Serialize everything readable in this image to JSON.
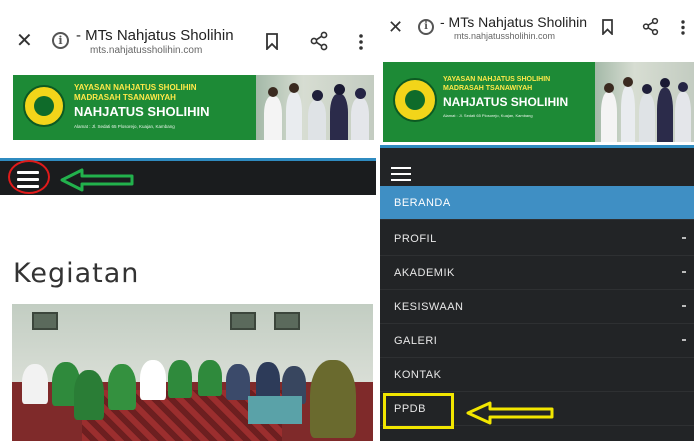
{
  "browser": {
    "close_icon": "close-icon",
    "info_icon": "info-icon",
    "info_glyph": "i",
    "bookmark_icon": "bookmark-icon",
    "share_icon": "share-icon",
    "menu_icon": "more-vertical-icon",
    "title": "- MTs Nahjatus Sholihin",
    "url": "mts.nahjatussholihin.com"
  },
  "banner": {
    "line1": "YAYASAN NAHJATUS SHOLIHIN",
    "line2": "MADRASAH TSANAWIYAH",
    "line3": "NAHJATUS SHOLIHIN",
    "line4": "Alamat : Jl. Sedati 65 Plosorejo, Kuajan, Kambang"
  },
  "page": {
    "heading": "Kegiatan"
  },
  "menu": {
    "items": [
      {
        "label": "BERANDA",
        "active": true,
        "has_submenu": false
      },
      {
        "label": "PROFIL",
        "active": false,
        "has_submenu": true
      },
      {
        "label": "AKADEMIK",
        "active": false,
        "has_submenu": true
      },
      {
        "label": "KESISWAAN",
        "active": false,
        "has_submenu": true
      },
      {
        "label": "GALERI",
        "active": false,
        "has_submenu": true
      },
      {
        "label": "KONTAK",
        "active": false,
        "has_submenu": false
      },
      {
        "label": "PPDB",
        "active": false,
        "has_submenu": false
      }
    ]
  },
  "annotations": {
    "arrow_left": "arrow-left-icon",
    "arrow_left_color": "#22b14c",
    "circle_color": "#e01a1a",
    "highlight_color": "#f2e600"
  },
  "colors": {
    "navbar": "#1a1c1e",
    "accent": "#3f8fc4",
    "banner_green": "#1d8a36"
  }
}
